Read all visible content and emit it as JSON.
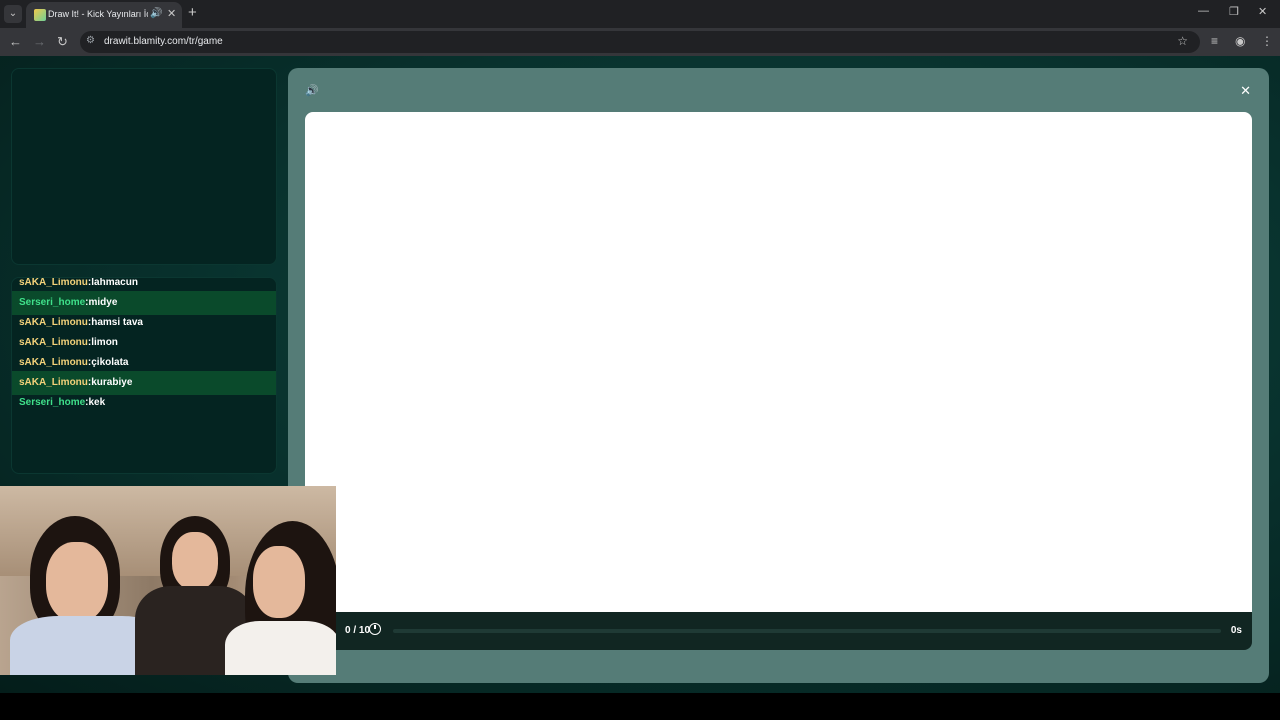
{
  "browser": {
    "tab_title": "Draw It! - Kick Yayınları İçin",
    "new_tab": "+",
    "tab_close": "✕",
    "url": "drawit.blamity.com/tr/game"
  },
  "chat": {
    "messages": [
      {
        "user": "sAKA_Limonu",
        "sep": ":",
        "text": "lahmacun",
        "style": "y",
        "highlight": false
      },
      {
        "user": "Serseri_home",
        "sep": ":",
        "text": "midye",
        "style": "g",
        "highlight": true
      },
      {
        "user": "sAKA_Limonu",
        "sep": ":",
        "text": "hamsi tava",
        "style": "y",
        "highlight": false
      },
      {
        "user": "sAKA_Limonu",
        "sep": ":",
        "text": "limon",
        "style": "y",
        "highlight": false
      },
      {
        "user": "sAKA_Limonu",
        "sep": ":",
        "text": "çikolata",
        "style": "y",
        "highlight": false
      },
      {
        "user": "sAKA_Limonu",
        "sep": ":",
        "text": "kurabiye",
        "style": "y",
        "highlight": true
      },
      {
        "user": "Serseri_home",
        "sep": ":",
        "text": "kek",
        "style": "g",
        "highlight": false
      }
    ]
  },
  "game": {
    "round": "0 / 10",
    "seconds": "0s",
    "progress": 0
  },
  "colors": {
    "accent_green": "#3fe08a",
    "accent_yellow": "#f4d27a",
    "panel": "#557c77"
  },
  "icons": {
    "sound": "speaker-icon",
    "close": "close-icon",
    "timer": "timer-icon"
  }
}
